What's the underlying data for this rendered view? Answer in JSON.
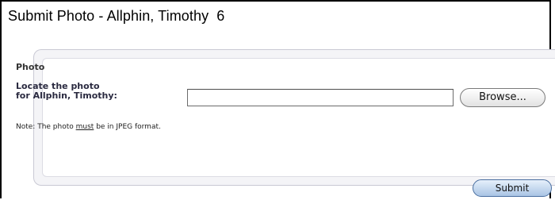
{
  "page": {
    "title": "Submit Photo - Allphin, Timothy",
    "title_number": "6"
  },
  "photo_section": {
    "heading": "Photo",
    "locate_label_line1": "Locate the photo",
    "locate_label_line2": "for Allphin, Timothy:",
    "file_input_value": "",
    "browse_label": "Browse...",
    "note_prefix": "Note: The photo ",
    "note_emphasis": "must",
    "note_suffix": " be in JPEG format."
  },
  "actions": {
    "submit_label": "Submit"
  },
  "colors": {
    "submit_accent": "#a9c4e4",
    "panel_background": "#f4f4f7"
  }
}
